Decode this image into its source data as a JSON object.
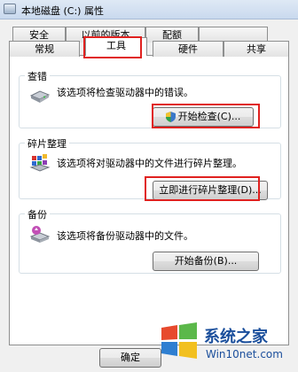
{
  "window": {
    "title": "本地磁盘 (C:) 属性"
  },
  "tabs": {
    "row_back": [
      "安全",
      "以前的版本",
      "配额"
    ],
    "row_front": [
      "常规",
      "工具",
      "硬件",
      "共享"
    ],
    "active": "工具"
  },
  "sections": {
    "check": {
      "label": "查错",
      "description": "该选项将检查驱动器中的错误。",
      "button": "开始检查(C)..."
    },
    "defrag": {
      "label": "碎片整理",
      "description": "该选项将对驱动器中的文件进行碎片整理。",
      "button": "立即进行碎片整理(D)..."
    },
    "backup": {
      "label": "备份",
      "description": "该选项将备份驱动器中的文件。",
      "button": "开始备份(B)..."
    }
  },
  "footer": {
    "ok": "确定"
  },
  "watermark": {
    "title": "系统之家",
    "site": "Win10net.com"
  },
  "colors": {
    "highlight": "#e0211f",
    "titlebar": "#dfe9f5",
    "watermark": "#1b4f9c"
  }
}
